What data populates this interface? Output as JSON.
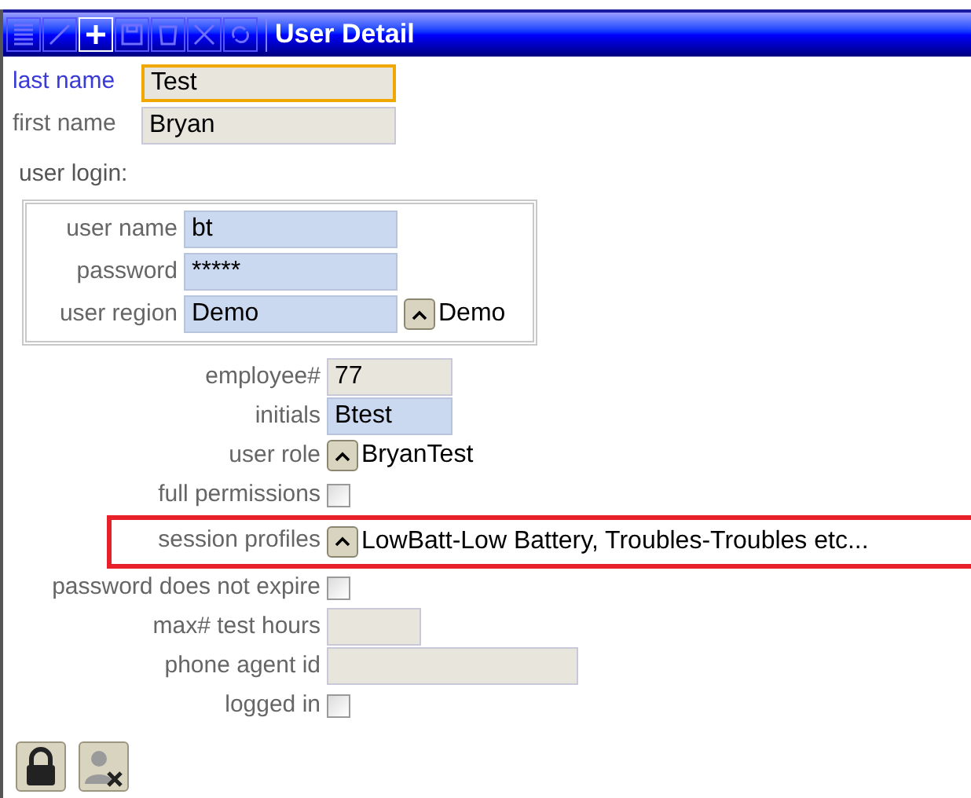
{
  "window": {
    "title": "User Detail"
  },
  "toolbar": [
    {
      "kind": "list",
      "enabled": false
    },
    {
      "kind": "edit",
      "enabled": false
    },
    {
      "kind": "add",
      "enabled": true
    },
    {
      "kind": "save",
      "enabled": false
    },
    {
      "kind": "delete",
      "enabled": false
    },
    {
      "kind": "cancel",
      "enabled": false
    },
    {
      "kind": "refresh",
      "enabled": false
    }
  ],
  "name_fields": [
    {
      "label": "last name",
      "value": "Test",
      "focused": true
    },
    {
      "label": "first name",
      "value": "Bryan",
      "focused": false
    }
  ],
  "user_login": {
    "title": "user login:",
    "fields": [
      {
        "kind": "text",
        "label": "user name",
        "value": "bt"
      },
      {
        "kind": "text",
        "label": "password",
        "value": "*****"
      },
      {
        "kind": "lookup",
        "label": "user region",
        "value": "Demo",
        "lookup_value": "Demo"
      }
    ]
  },
  "details": [
    {
      "kind": "field",
      "label": "employee#",
      "value": "77",
      "editable": false
    },
    {
      "kind": "field",
      "label": "initials",
      "value": "Btest",
      "editable": true
    },
    {
      "kind": "lookup",
      "label": "user role",
      "value": "BryanTest"
    },
    {
      "kind": "checkbox",
      "label": "full permissions",
      "checked": false
    },
    {
      "kind": "lookup",
      "label": "session profiles",
      "value": "LowBatt-Low Battery, Troubles-Troubles etc...",
      "highlighted": true
    },
    {
      "kind": "checkbox",
      "label": "password does not expire",
      "checked": false
    },
    {
      "kind": "narrowfield",
      "label": "max# test hours",
      "editable": false
    },
    {
      "kind": "widefield",
      "label": "phone agent id",
      "editable": false
    },
    {
      "kind": "checkbox",
      "label": "logged in",
      "checked": false
    }
  ],
  "footer_buttons": [
    {
      "kind": "lock",
      "enabled": true
    },
    {
      "kind": "remove-user",
      "enabled": false
    }
  ]
}
